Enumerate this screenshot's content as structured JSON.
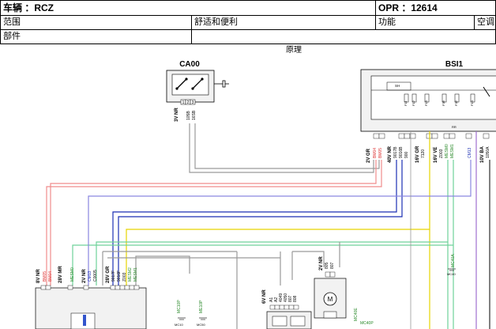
{
  "header": {
    "vehicle": "车辆 ：RCZ",
    "opr": "OPR ：12614",
    "scope_label": "范围",
    "scope_value": "舒适和便利",
    "function_label": "功能",
    "function_value": "空调",
    "part_label": "部件"
  },
  "diagram": {
    "title": "原理",
    "components": {
      "ca00": "CA00",
      "bsi1": "BSI1"
    },
    "ca00_labels": {
      "conn": "3V NR",
      "w1": "105B",
      "w2": "16SB"
    },
    "bsi_labels": {
      "c1": "2V GR",
      "c1a": "BM04",
      "c1b": "BM05",
      "c2": "40V NR",
      "c2a": "9017B",
      "c2b": "9016B",
      "c2c": "900",
      "c3": "16V GR",
      "c3a": "7120",
      "c4": "16V VE",
      "c4a": "Z003",
      "c4b": "MESM0",
      "c4c": "MESM1",
      "c5": "CM13",
      "c6": "10V BA",
      "c6a": "1050A",
      "fuse_f11": "F11",
      "fuse_f12": "F12",
      "fuse_f13": "F13",
      "fuse_f36": "F36",
      "fuse_f32": "F32",
      "fuse_f14": "F14",
      "sh": "SH",
      "rr": "RR",
      "pins": [
        "1",
        "2",
        "3",
        "11",
        "6",
        "5",
        "4",
        "9",
        "16",
        "1",
        "9"
      ]
    },
    "lower_left": {
      "a": "8V NR",
      "a1": "BM05",
      "a2": "BM04",
      "b": "28V MR",
      "b1": "MESM0",
      "c": "2V NR",
      "c1": "CM13",
      "c2": "C0005",
      "d": "28V GR",
      "d1": "9017F",
      "d2": "9016F",
      "d3": "Z003",
      "d4": "MESM2",
      "d5": "MESM1"
    },
    "lower_mid": {
      "a": "6V NR",
      "a1": "A1",
      "a2": "A2",
      "a3": "4049",
      "a4": "4050",
      "a5": "807",
      "a6": "808"
    },
    "lower_right": {
      "a": "2V NR",
      "a1": "805",
      "a2": "807"
    },
    "grounds": [
      "MC10P",
      "MC10",
      "ME10P",
      "MC50",
      "MC40",
      "MC40P",
      "MC40E"
    ],
    "mc40a": "MC40A"
  }
}
